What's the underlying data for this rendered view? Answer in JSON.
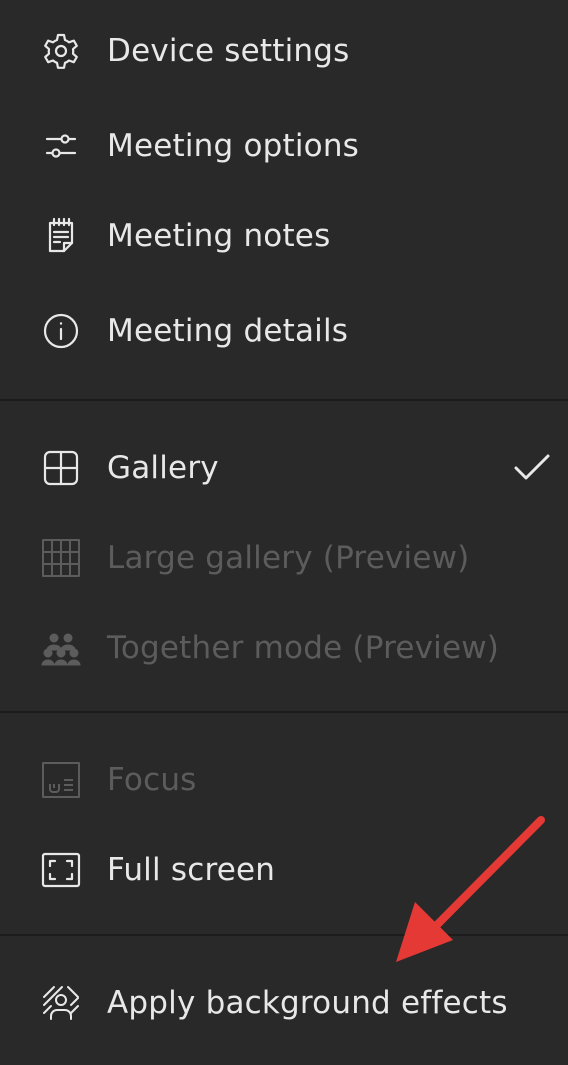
{
  "menu": {
    "items": [
      {
        "label": "Device settings",
        "icon": "gear-icon"
      },
      {
        "label": "Meeting options",
        "icon": "sliders-icon"
      },
      {
        "label": "Meeting notes",
        "icon": "notepad-icon"
      },
      {
        "label": "Meeting details",
        "icon": "info-icon"
      },
      {
        "label": "Gallery",
        "icon": "gallery-grid-icon",
        "checked": true
      },
      {
        "label": "Large gallery (Preview)",
        "icon": "large-gallery-grid-icon",
        "disabled": true
      },
      {
        "label": "Together mode (Preview)",
        "icon": "together-mode-icon",
        "disabled": true
      },
      {
        "label": "Focus",
        "icon": "focus-icon",
        "disabled": true
      },
      {
        "label": "Full screen",
        "icon": "fullscreen-icon"
      },
      {
        "label": "Apply background effects",
        "icon": "background-effects-icon"
      }
    ]
  },
  "colors": {
    "background": "#292929",
    "text": "#e8e8e8",
    "disabled_text": "#5c5c5c",
    "divider": "#1c1c1c",
    "annotation_arrow": "#e53935"
  }
}
